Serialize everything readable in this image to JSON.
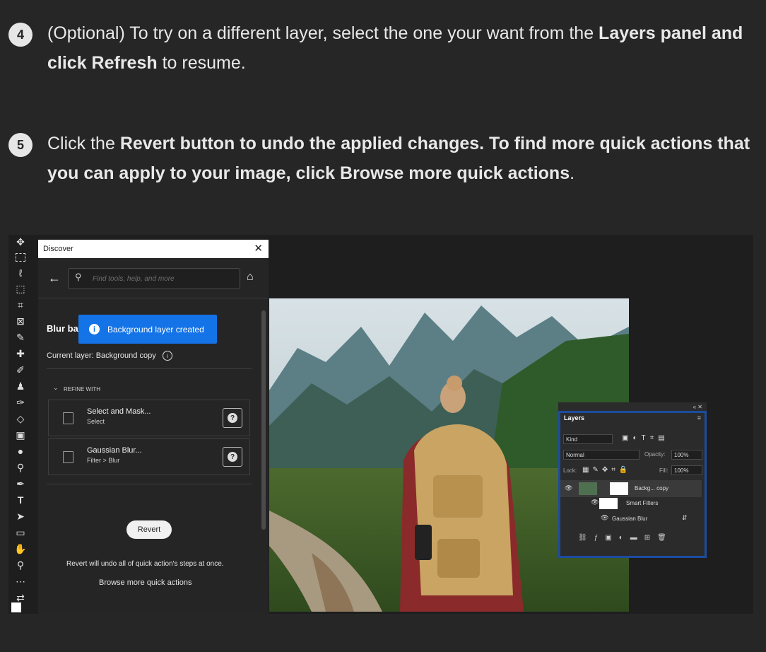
{
  "steps": [
    {
      "number": "4",
      "text": {
        "a": "(Optional) To try on a different layer, select the one your want from the ",
        "b": "Layers panel and click Refresh",
        "c": " to resume."
      }
    },
    {
      "number": "5",
      "text": {
        "a": "Click the ",
        "b": "Revert button to undo the applied changes. To find more quick actions that you can apply to your image, click Browse more quick actions",
        "c": "."
      }
    }
  ],
  "discover": {
    "title": "Discover",
    "search_placeholder": "Find tools, help, and more",
    "heading": "Blur ba",
    "toast": "Background layer created",
    "current_layer": "Current layer: Background copy",
    "refine_label": "REFINE WITH",
    "refine_items": [
      {
        "name": "Select and Mask...",
        "path": "Select"
      },
      {
        "name": "Gaussian Blur...",
        "path": "Filter > Blur"
      }
    ],
    "revert_label": "Revert",
    "revert_note": "Revert will undo all of quick action's steps at once.",
    "browse_link": "Browse more quick actions"
  },
  "layers_panel": {
    "tab": "Layers",
    "kind": "Kind",
    "blend_mode": "Normal",
    "opacity_label": "Opacity:",
    "opacity_value": "100%",
    "lock_label": "Lock:",
    "fill_label": "Fill:",
    "fill_value": "100%",
    "layer_name": "Backg... copy",
    "smart_filters": "Smart Filters",
    "filter_name": "Gaussian Blur"
  },
  "colors": {
    "page_bg": "#262626",
    "toast_blue": "#1473e6",
    "layers_highlight": "#1c4ca0"
  }
}
